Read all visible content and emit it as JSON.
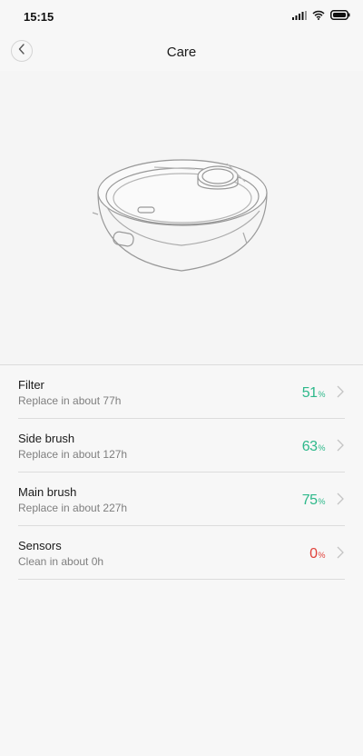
{
  "status_bar": {
    "time": "15:15",
    "icons": [
      "signal-icon",
      "wifi-icon",
      "battery-icon"
    ]
  },
  "header": {
    "title": "Care",
    "back_icon": "chevron-left-icon"
  },
  "hero": {
    "image": "robot-vacuum-illustration"
  },
  "items": [
    {
      "title": "Filter",
      "subtitle": "Replace in about 77h",
      "value": "51",
      "unit": "%",
      "status_color": "#2db88a"
    },
    {
      "title": "Side brush",
      "subtitle": "Replace in about 127h",
      "value": "63",
      "unit": "%",
      "status_color": "#2db88a"
    },
    {
      "title": "Main brush",
      "subtitle": "Replace in about 227h",
      "value": "75",
      "unit": "%",
      "status_color": "#2db88a"
    },
    {
      "title": "Sensors",
      "subtitle": "Clean in about 0h",
      "value": "0",
      "unit": "%",
      "status_color": "#e0413a"
    }
  ],
  "colors": {
    "good": "#2db88a",
    "bad": "#e0413a",
    "background": "#f7f7f7",
    "divider": "#dcdcdc"
  }
}
